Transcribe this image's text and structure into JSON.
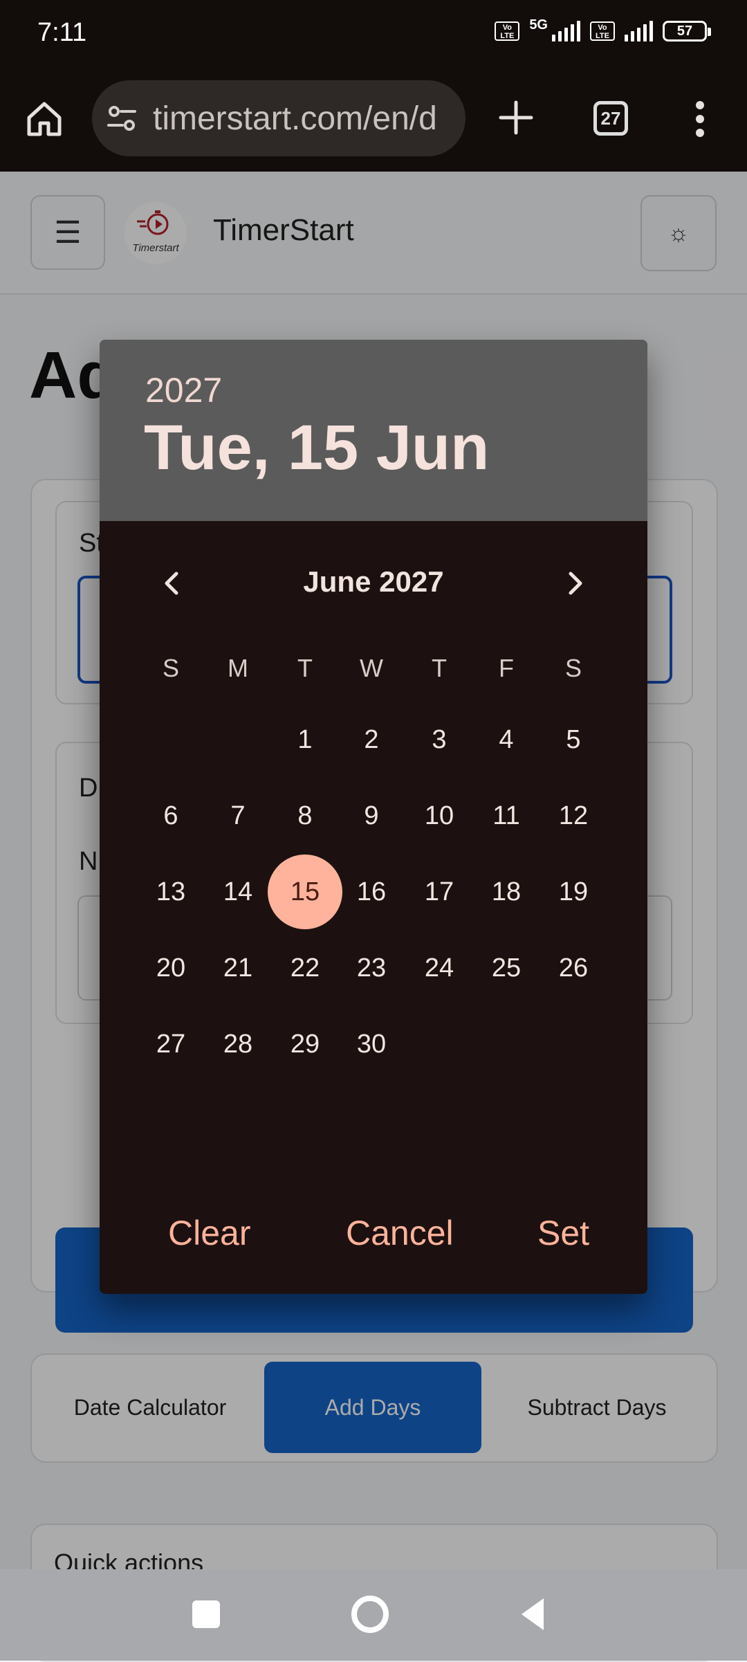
{
  "status_bar": {
    "time": "7:11",
    "network": "5G",
    "volte_label": "Vo LTE",
    "battery": "57"
  },
  "browser": {
    "url": "timerstart.com/en/d",
    "tab_count": "27"
  },
  "site": {
    "logo_caption": "Timerstart",
    "title": "TimerStart",
    "menu_icon": "☰",
    "theme_icon": "☼",
    "heading_partial": "Ad"
  },
  "form": {
    "start_label_partial": "St",
    "days_label_partial": "D",
    "number_label_partial": "N"
  },
  "mode_tabs": [
    {
      "label": "Date Calculator",
      "active": false
    },
    {
      "label": "Add Days",
      "active": true
    },
    {
      "label": "Subtract Days",
      "active": false
    }
  ],
  "quick_actions": {
    "title": "Quick actions"
  },
  "date_picker": {
    "year": "2027",
    "selected_date": "Tue, 15 Jun",
    "month_label": "June 2027",
    "weekdays": [
      "S",
      "M",
      "T",
      "W",
      "T",
      "F",
      "S"
    ],
    "first_weekday_index": 2,
    "days_in_month": 30,
    "selected_day": 15,
    "actions": {
      "clear": "Clear",
      "cancel": "Cancel",
      "set": "Set"
    },
    "accent_color": "#ffb39c"
  },
  "nav_bar": {
    "icons": [
      "recent-apps-icon",
      "home-icon",
      "back-icon"
    ]
  }
}
